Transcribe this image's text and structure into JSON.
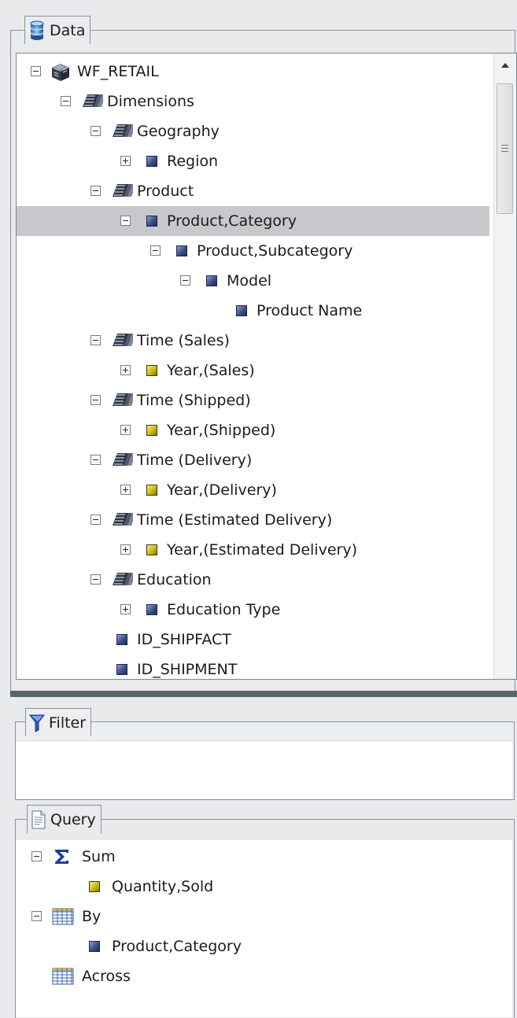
{
  "data_panel": {
    "title": "Data",
    "tree": [
      {
        "label": "WF_RETAIL",
        "level": 0,
        "toggle": "minus",
        "icon": "database-cube-icon"
      },
      {
        "label": "Dimensions",
        "level": 1,
        "toggle": "minus",
        "icon": "dimension-icon"
      },
      {
        "label": "Geography",
        "level": 2,
        "toggle": "minus",
        "icon": "dimension-icon"
      },
      {
        "label": "Region",
        "level": 3,
        "toggle": "plus",
        "icon": "field-blue-icon"
      },
      {
        "label": "Product",
        "level": 2,
        "toggle": "minus",
        "icon": "dimension-icon"
      },
      {
        "label": "Product,Category",
        "level": 3,
        "toggle": "minus",
        "icon": "field-blue-icon",
        "selected": true
      },
      {
        "label": "Product,Subcategory",
        "level": 4,
        "toggle": "minus",
        "icon": "field-blue-icon"
      },
      {
        "label": "Model",
        "level": 5,
        "toggle": "minus",
        "icon": "field-blue-icon"
      },
      {
        "label": "Product Name",
        "level": 6,
        "toggle": "none",
        "icon": "field-blue-icon"
      },
      {
        "label": "Time (Sales)",
        "level": 2,
        "toggle": "minus",
        "icon": "dimension-icon"
      },
      {
        "label": "Year,(Sales)",
        "level": 3,
        "toggle": "plus",
        "icon": "field-yellow-icon"
      },
      {
        "label": "Time (Shipped)",
        "level": 2,
        "toggle": "minus",
        "icon": "dimension-icon"
      },
      {
        "label": "Year,(Shipped)",
        "level": 3,
        "toggle": "plus",
        "icon": "field-yellow-icon"
      },
      {
        "label": "Time (Delivery)",
        "level": 2,
        "toggle": "minus",
        "icon": "dimension-icon"
      },
      {
        "label": "Year,(Delivery)",
        "level": 3,
        "toggle": "plus",
        "icon": "field-yellow-icon"
      },
      {
        "label": "Time (Estimated Delivery)",
        "level": 2,
        "toggle": "minus",
        "icon": "dimension-icon"
      },
      {
        "label": "Year,(Estimated Delivery)",
        "level": 3,
        "toggle": "plus",
        "icon": "field-yellow-icon"
      },
      {
        "label": "Education",
        "level": 2,
        "toggle": "minus",
        "icon": "dimension-icon"
      },
      {
        "label": "Education Type",
        "level": 3,
        "toggle": "plus",
        "icon": "field-blue-icon"
      },
      {
        "label": "ID_SHIPFACT",
        "level": 2,
        "toggle": "none",
        "icon": "field-blue-icon"
      },
      {
        "label": "ID_SHIPMENT",
        "level": 2,
        "toggle": "none",
        "icon": "field-blue-icon"
      }
    ]
  },
  "filter_panel": {
    "title": "Filter"
  },
  "query_panel": {
    "title": "Query",
    "tree": [
      {
        "label": "Sum",
        "level": 0,
        "toggle": "minus",
        "icon": "sigma-icon"
      },
      {
        "label": "Quantity,Sold",
        "level": 1,
        "toggle": "none",
        "icon": "field-yellow-icon"
      },
      {
        "label": "By",
        "level": 0,
        "toggle": "minus",
        "icon": "grid-icon"
      },
      {
        "label": "Product,Category",
        "level": 1,
        "toggle": "none",
        "icon": "field-blue-icon"
      },
      {
        "label": "Across",
        "level": 0,
        "toggle": "none",
        "icon": "grid-icon"
      }
    ]
  },
  "colors": {
    "selection": "#c8c7cb",
    "field_blue": "#3d4f8a",
    "field_yellow": "#c8bb18",
    "sigma": "#1b3f9e"
  }
}
